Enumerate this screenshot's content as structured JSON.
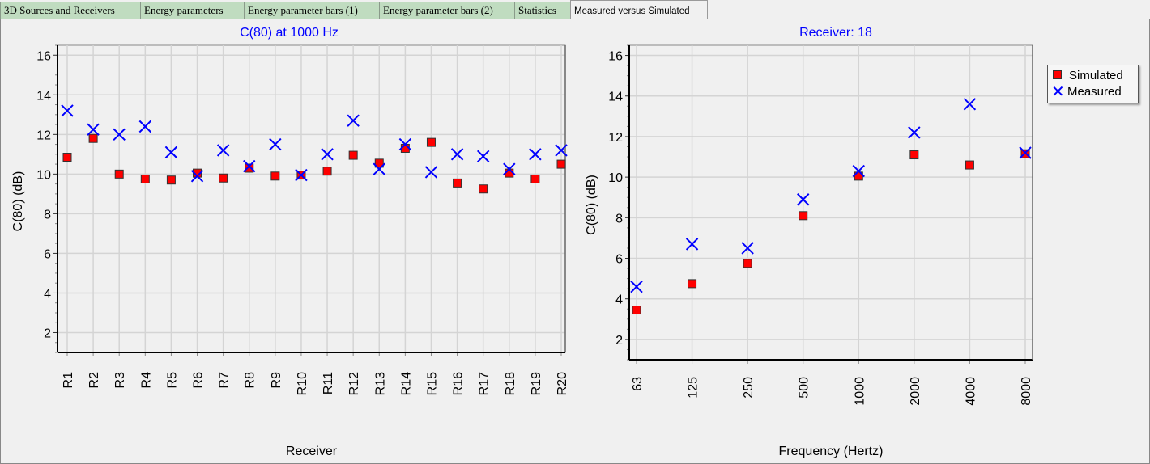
{
  "tabs": [
    {
      "label": "3D Sources and Receivers",
      "active": false
    },
    {
      "label": "Energy parameters",
      "active": false
    },
    {
      "label": "Energy parameter bars (1)",
      "active": false
    },
    {
      "label": "Energy parameter bars (2)",
      "active": false
    },
    {
      "label": "Statistics",
      "active": false
    },
    {
      "label": "Measured versus Simulated",
      "active": true
    }
  ],
  "colors": {
    "simulated": "#ff0000",
    "measured": "#0000ff",
    "title": "#0000ff"
  },
  "legend": {
    "simulated": "Simulated",
    "measured": "Measured"
  },
  "chart_data": [
    {
      "type": "scatter",
      "title": "C(80) at 1000 Hz",
      "xlabel": "Receiver",
      "ylabel": "C(80) (dB)",
      "ylim": [
        1,
        16.5
      ],
      "yticks": [
        "2",
        "4",
        "6",
        "8",
        "10",
        "12",
        "14",
        "16"
      ],
      "grid": true,
      "categories": [
        "R1",
        "R2",
        "R3",
        "R4",
        "R5",
        "R6",
        "R7",
        "R8",
        "R9",
        "R10",
        "R11",
        "R12",
        "R13",
        "R14",
        "R15",
        "R16",
        "R17",
        "R18",
        "R19",
        "R20"
      ],
      "series": [
        {
          "name": "Simulated",
          "marker": "square",
          "values": [
            10.85,
            11.8,
            10.0,
            9.75,
            9.7,
            10.05,
            9.8,
            10.3,
            9.9,
            9.95,
            10.15,
            10.95,
            10.55,
            11.3,
            11.6,
            9.55,
            9.25,
            10.05,
            9.75,
            10.5
          ]
        },
        {
          "name": "Measured",
          "marker": "x",
          "values": [
            13.2,
            12.25,
            12.0,
            12.4,
            11.1,
            9.9,
            11.2,
            10.4,
            11.5,
            9.95,
            11.0,
            12.7,
            10.25,
            11.5,
            10.1,
            11.0,
            10.9,
            10.25,
            11.0,
            11.2
          ]
        }
      ]
    },
    {
      "type": "scatter",
      "title": "Receiver: 18",
      "xlabel": "Frequency (Hertz)",
      "ylabel": "C(80) (dB)",
      "ylim": [
        1,
        16.5
      ],
      "yticks": [
        "2",
        "4",
        "6",
        "8",
        "10",
        "12",
        "14",
        "16"
      ],
      "grid": true,
      "legend_position": "outside-top-right",
      "categories": [
        "63",
        "125",
        "250",
        "500",
        "1000",
        "2000",
        "4000",
        "8000"
      ],
      "series": [
        {
          "name": "Simulated",
          "marker": "square",
          "values": [
            3.45,
            4.75,
            5.75,
            8.1,
            10.05,
            11.1,
            10.6,
            11.15
          ]
        },
        {
          "name": "Measured",
          "marker": "x",
          "values": [
            4.6,
            6.7,
            6.5,
            8.9,
            10.3,
            12.2,
            13.6,
            11.2
          ]
        }
      ]
    }
  ]
}
